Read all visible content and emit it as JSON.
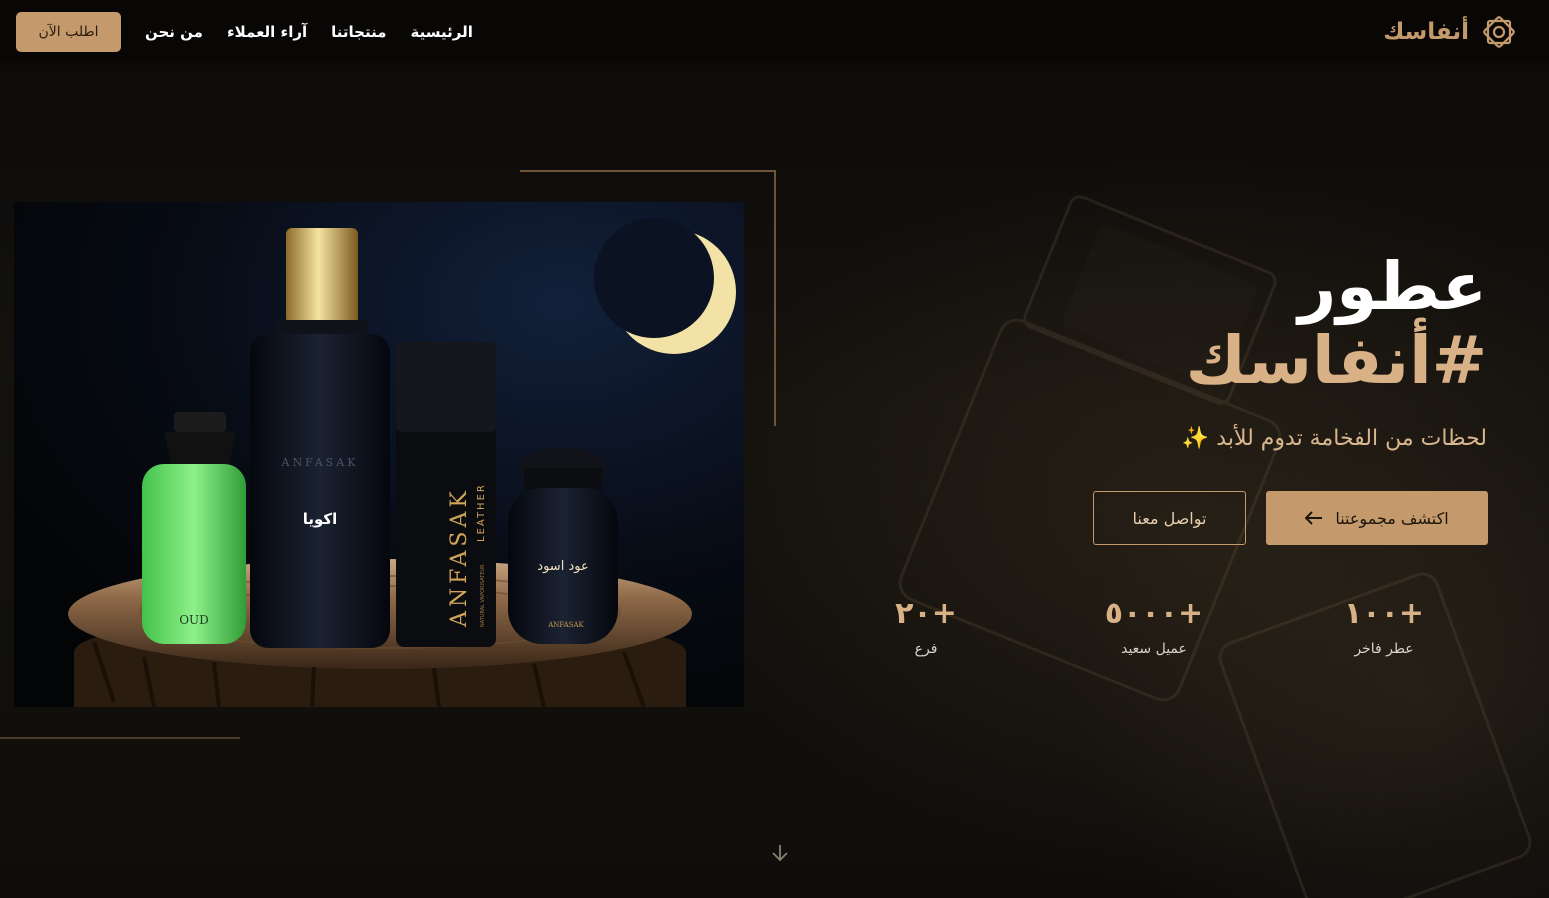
{
  "nav": {
    "brand": "أنفاسك",
    "order_button": "اطلب الآن",
    "links": [
      "الرئيسية",
      "منتجاتنا",
      "آراء العملاء",
      "من نحن"
    ]
  },
  "hero": {
    "headline_line1": "عطور",
    "headline_line2": "#أنفاسك",
    "tagline": "لحظات من الفخامة تدوم للأبد",
    "tagline_emoji": "✨",
    "primary_cta": "اكتشف مجموعتنا",
    "secondary_cta": "تواصل معنا"
  },
  "product_image": {
    "bottle_oud_label": "OUD",
    "bottle_tall_label": "اكويا",
    "bottle_tall_brand": "ANFASAK",
    "bottle_box_brand": "ANFASAK",
    "bottle_box_sub": "LEATHER",
    "bottle_box_small": "NATURAL VAPORISATEUR",
    "jar_label": "عود اسود",
    "jar_brand": "ANFASAK"
  },
  "stats": [
    {
      "value": "١٠٠+",
      "label": "عطر فاخر"
    },
    {
      "value": "٥٠٠٠+",
      "label": "عميل سعيد"
    },
    {
      "value": "٢٠+",
      "label": "فرع"
    }
  ],
  "colors": {
    "accent": "#c49a6c",
    "accent_light": "#d8b186",
    "background": "#0e0d0b",
    "navbar": "#080706"
  },
  "icons": {
    "logo": "geometric-star-logo-icon",
    "cta_arrow": "arrow-left-icon",
    "scroll": "arrow-down-icon"
  }
}
